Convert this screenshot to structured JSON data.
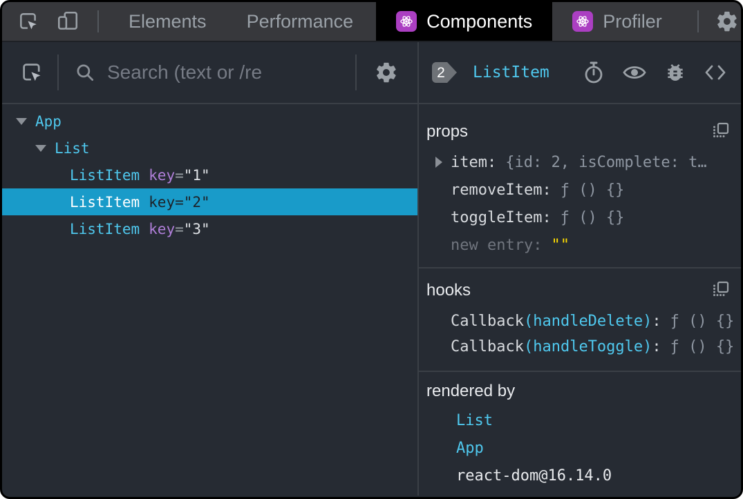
{
  "tabbar": {
    "tabs": [
      {
        "label": "Elements"
      },
      {
        "label": "Performance"
      },
      {
        "label": "Components"
      },
      {
        "label": "Profiler"
      }
    ]
  },
  "left_panel": {
    "search_placeholder": "Search (text or /re",
    "tree": [
      {
        "name": "App"
      },
      {
        "name": "List"
      },
      {
        "name": "ListItem",
        "key_label": "key",
        "eq": "=",
        "key_value": "\"1\""
      },
      {
        "name": "ListItem",
        "key_label": "key",
        "eq": "=",
        "key_value": "\"2\""
      },
      {
        "name": "ListItem",
        "key_label": "key",
        "eq": "=",
        "key_value": "\"3\""
      }
    ]
  },
  "right_panel": {
    "badge": "2",
    "component": "ListItem",
    "props": {
      "title": "props",
      "rows": [
        {
          "name": "item:",
          "value": "{id: 2, isComplete: t…"
        },
        {
          "name": "removeItem:",
          "value": "ƒ () {}"
        },
        {
          "name": "toggleItem:",
          "value": "ƒ () {}"
        },
        {
          "name": "new entry:",
          "value": "\"\""
        }
      ]
    },
    "hooks": {
      "title": "hooks",
      "rows": [
        {
          "fn": "Callback",
          "arg": "(handleDelete)",
          "colon": ":",
          "value": "ƒ () {}"
        },
        {
          "fn": "Callback",
          "arg": "(handleToggle)",
          "colon": ":",
          "value": "ƒ () {}"
        }
      ]
    },
    "rendered_by": {
      "title": "rendered by",
      "items": [
        "List",
        "App",
        "react-dom@16.14.0"
      ]
    }
  },
  "colors": {
    "component_name": "#4fc8ee",
    "selected_row_bg": "#199bc9",
    "key_attr": "#b07fd9",
    "string_yellow": "#ffdd00",
    "react_icon_purple": "#ab3fc2"
  }
}
